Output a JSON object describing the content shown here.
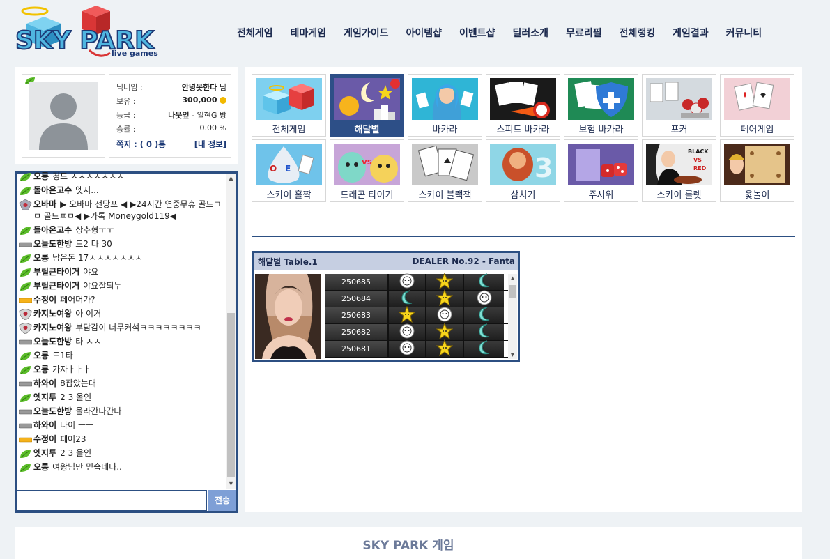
{
  "header": {
    "logo_text": "SKY PARK",
    "logo_subtext": "live games",
    "nav": [
      "전체게임",
      "테마게임",
      "게임가이드",
      "아이템샵",
      "이벤트샵",
      "딜러소개",
      "무료리필",
      "전체랭킹",
      "게임결과",
      "커뮤니티"
    ]
  },
  "profile": {
    "nickname_label": "닉네임 :",
    "nickname": "안녕못한다",
    "nickname_suffix": "님",
    "holding_label": "보유 :",
    "holding": "300,000",
    "grade_label": "등급 :",
    "grade": "나뭇잎",
    "grade_suffix": "- 일현G 방",
    "winrate_label": "승률 :",
    "winrate": "0.00 %",
    "message_link": "쪽지 : ( 0 )통",
    "myinfo_link": "[내 정보]"
  },
  "chat": {
    "messages": [
      {
        "icon": "leaf",
        "nick": "오롱",
        "text": "경드 ㅅㅅㅅㅅㅅㅅㅅ"
      },
      {
        "icon": "leaf",
        "nick": "돌아온고수",
        "text": "엣지..."
      },
      {
        "icon": "crown",
        "nick": "오바마",
        "text": "▶ 오바마 전당포 ◀ ▶24시간 연중무휴 골드ㄱㅁ 골드ㅍㅁ◀ ▶카톡 Moneygold119◀"
      },
      {
        "icon": "leaf",
        "nick": "돌아온고수",
        "text": "상추형ㅜㅜ"
      },
      {
        "icon": "bar-gray",
        "nick": "오늘도한방",
        "text": "드2 타 30"
      },
      {
        "icon": "leaf",
        "nick": "오롱",
        "text": "남은돈 17ㅅㅅㅅㅅㅅㅅㅅ"
      },
      {
        "icon": "leaf",
        "nick": "부릴큰타이거",
        "text": "야요"
      },
      {
        "icon": "leaf",
        "nick": "부릴큰타이거",
        "text": "야요잘되누"
      },
      {
        "icon": "bar-gold",
        "nick": "수정이",
        "text": "페어머가?"
      },
      {
        "icon": "shield",
        "nick": "카지노여왕",
        "text": "아 이거"
      },
      {
        "icon": "shield",
        "nick": "카지노여왕",
        "text": "부담감이 너무커섴ㅋㅋㅋㅋㅋㅋㅋㅋ"
      },
      {
        "icon": "bar-gray",
        "nick": "오늘도한방",
        "text": "타 ㅅㅅ"
      },
      {
        "icon": "leaf",
        "nick": "오롱",
        "text": "드1타"
      },
      {
        "icon": "leaf",
        "nick": "오롱",
        "text": "가자ㅏㅏㅏ"
      },
      {
        "icon": "bar-gray",
        "nick": "하와이",
        "text": "8잡았는대"
      },
      {
        "icon": "leaf",
        "nick": "엣지투",
        "text": "2 3 올인"
      },
      {
        "icon": "bar-gray",
        "nick": "오늘도한방",
        "text": "올라간다간다"
      },
      {
        "icon": "bar-gray",
        "nick": "하와이",
        "text": "타이 ㅡㅡ"
      },
      {
        "icon": "bar-gold",
        "nick": "수정이",
        "text": "페어23"
      },
      {
        "icon": "leaf",
        "nick": "엣지투",
        "text": "2 3 올인"
      },
      {
        "icon": "leaf",
        "nick": "오롱",
        "text": "여왕님만 믿습네다.."
      }
    ],
    "input_value": "",
    "send_label": "전송"
  },
  "games": [
    {
      "label": "전체게임",
      "thumb": "allgames",
      "active": false
    },
    {
      "label": "해달별",
      "thumb": "sunmoonstar",
      "active": true
    },
    {
      "label": "바카라",
      "thumb": "baccarat",
      "active": false
    },
    {
      "label": "스피드 바카라",
      "thumb": "speedbaccarat",
      "active": false
    },
    {
      "label": "보험 바카라",
      "thumb": "insurance",
      "active": false
    },
    {
      "label": "포커",
      "thumb": "poker",
      "active": false
    },
    {
      "label": "페어게임",
      "thumb": "pair",
      "active": false
    },
    {
      "label": "스카이 홀짝",
      "thumb": "oddeven",
      "active": false
    },
    {
      "label": "드래곤 타이거",
      "thumb": "dragontiger",
      "active": false
    },
    {
      "label": "스카이 블랙잭",
      "thumb": "blackjack",
      "active": false
    },
    {
      "label": "삼치기",
      "thumb": "three",
      "active": false
    },
    {
      "label": "주사위",
      "thumb": "dice",
      "active": false
    },
    {
      "label": "스카이 룰렛",
      "thumb": "roulette",
      "active": false
    },
    {
      "label": "윷놀이",
      "thumb": "yut",
      "active": false
    }
  ],
  "table": {
    "title": "해달별 Table.1",
    "dealer": "DEALER No.92 - Fanta",
    "rows": [
      {
        "id": "250685",
        "cells": [
          "sun",
          "star",
          "moon"
        ]
      },
      {
        "id": "250684",
        "cells": [
          "moon",
          "star",
          "sun"
        ]
      },
      {
        "id": "250683",
        "cells": [
          "star",
          "sun",
          "moon"
        ]
      },
      {
        "id": "250682",
        "cells": [
          "sun",
          "star",
          "moon"
        ]
      },
      {
        "id": "250681",
        "cells": [
          "sun",
          "star",
          "moon"
        ]
      }
    ]
  },
  "footer": {
    "title": "SKY PARK 게임"
  }
}
